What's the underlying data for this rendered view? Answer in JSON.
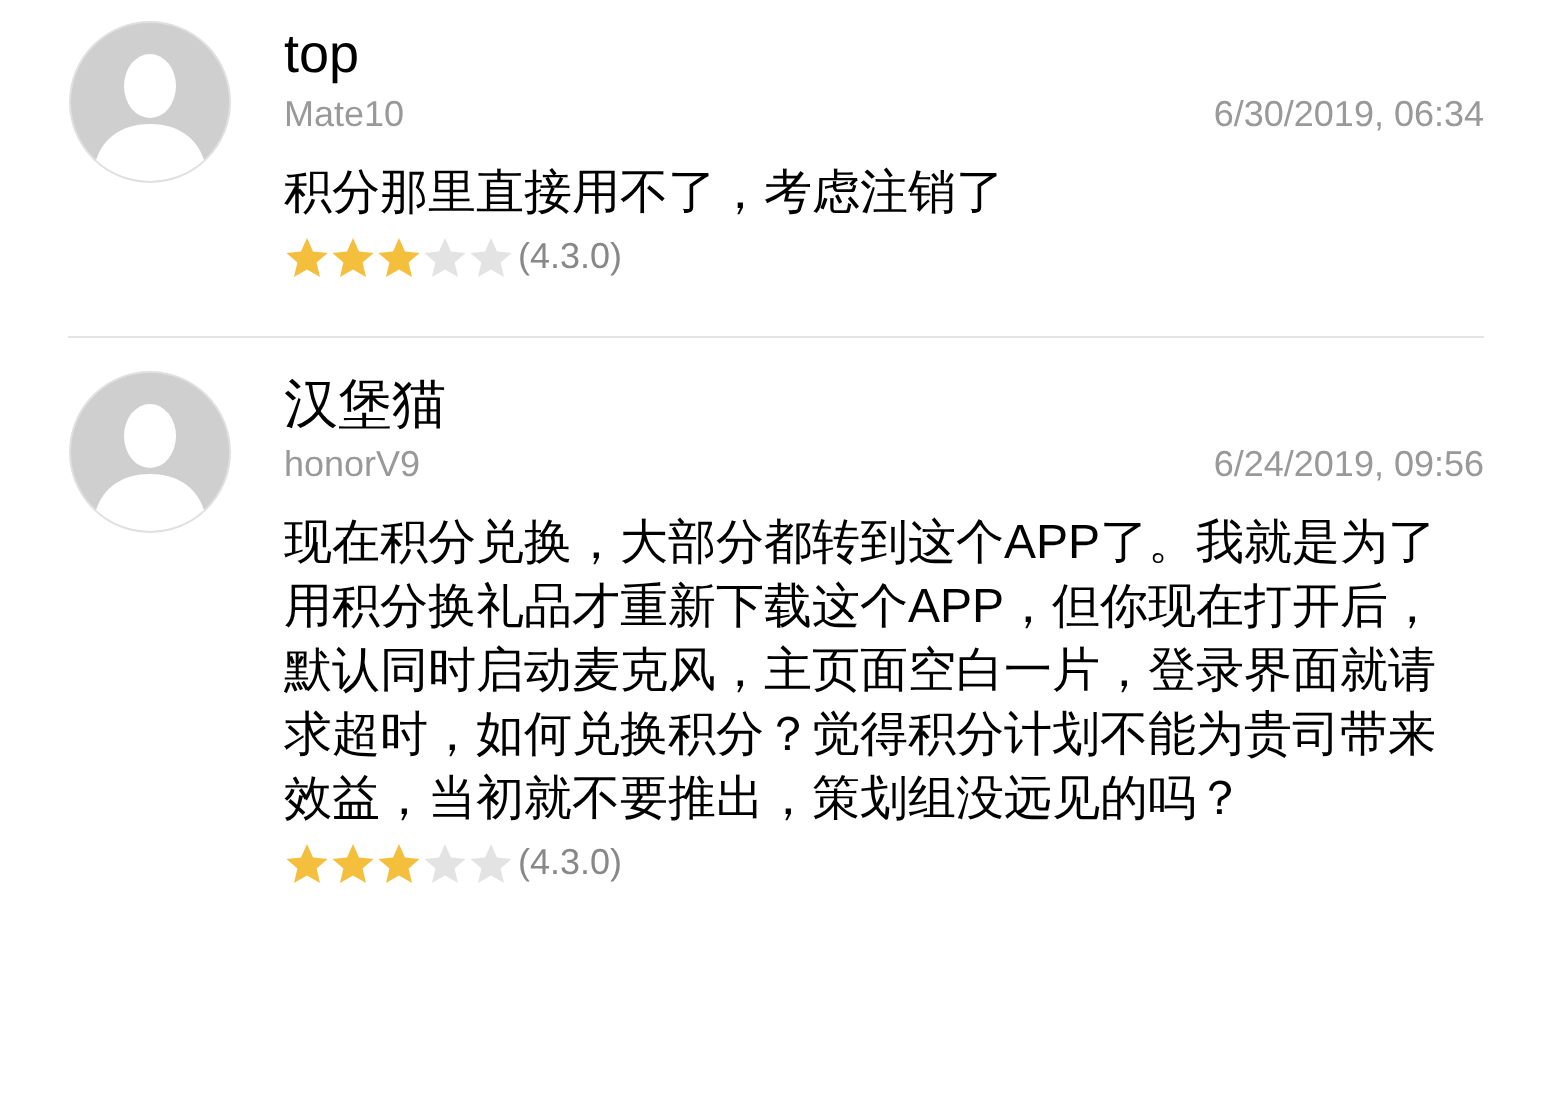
{
  "reviews": [
    {
      "name": "top",
      "device": "Mate10",
      "date": "6/30/2019, 06:34",
      "text": "积分那里直接用不了，考虑注销了",
      "stars": 3,
      "version": "(4.3.0)"
    },
    {
      "name": "汉堡猫",
      "device": "honorV9",
      "date": "6/24/2019, 09:56",
      "text": "现在积分兑换，大部分都转到这个APP了。我就是为了用积分换礼品才重新下载这个APP，但你现在打开后，默认同时启动麦克风，主页面空白一片，登录界面就请求超时，如何兑换积分？觉得积分计划不能为贵司带来效益，当初就不要推出，策划组没远见的吗？",
      "stars": 3,
      "version": "(4.3.0)"
    }
  ]
}
